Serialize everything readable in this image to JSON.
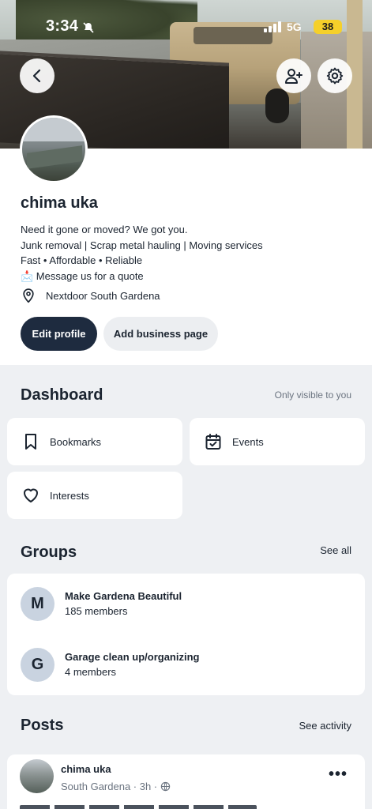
{
  "status_bar": {
    "time": "3:34",
    "network": "5G",
    "battery": "38"
  },
  "profile": {
    "name": "chima uka",
    "bio": [
      "Need it gone or moved? We got you.",
      "Junk removal | Scrap metal hauling | Moving services",
      "Fast • Affordable • Reliable",
      "📩 Message us for a quote"
    ],
    "location": "Nextdoor South Gardena",
    "edit_profile_label": "Edit profile",
    "add_business_label": "Add business page"
  },
  "dashboard": {
    "title": "Dashboard",
    "visibility_note": "Only visible to you",
    "items": [
      {
        "label": "Bookmarks",
        "icon": "bookmark-icon"
      },
      {
        "label": "Events",
        "icon": "calendar-check-icon"
      },
      {
        "label": "Interests",
        "icon": "heart-icon"
      }
    ]
  },
  "groups": {
    "title": "Groups",
    "see_all_label": "See all",
    "items": [
      {
        "initial": "M",
        "name": "Make Gardena Beautiful",
        "members": "185 members"
      },
      {
        "initial": "G",
        "name": "Garage clean up/organizing",
        "members": "4 members"
      }
    ]
  },
  "posts": {
    "title": "Posts",
    "see_activity_label": "See activity",
    "items": [
      {
        "author": "chima uka",
        "meta": "South Gardena · 3h ·"
      }
    ]
  }
}
